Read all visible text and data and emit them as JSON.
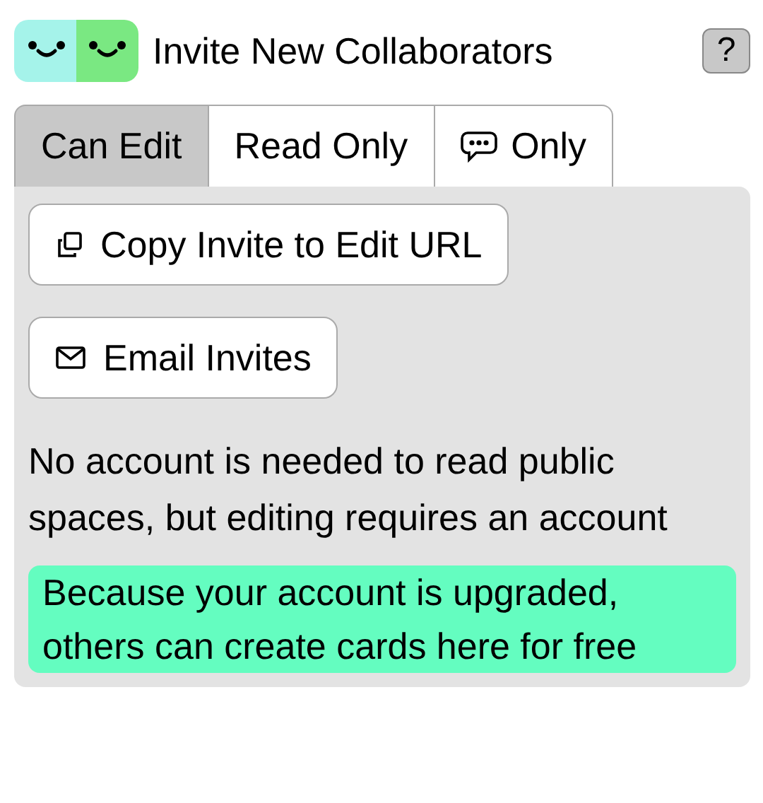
{
  "header": {
    "title": "Invite New Collaborators",
    "help": "?"
  },
  "tabs": [
    {
      "label": "Can Edit",
      "kind": "text",
      "selected": true
    },
    {
      "label": "Read Only",
      "kind": "text",
      "selected": false
    },
    {
      "label": "Only",
      "kind": "with-icon",
      "selected": false
    }
  ],
  "buttons": [
    "Copy Invite to Edit URL",
    "Email Invites"
  ],
  "note": "No account is needed to read public spaces, but editing requires an account",
  "notice": "Because your account is upgraded, others can create cards here for free"
}
